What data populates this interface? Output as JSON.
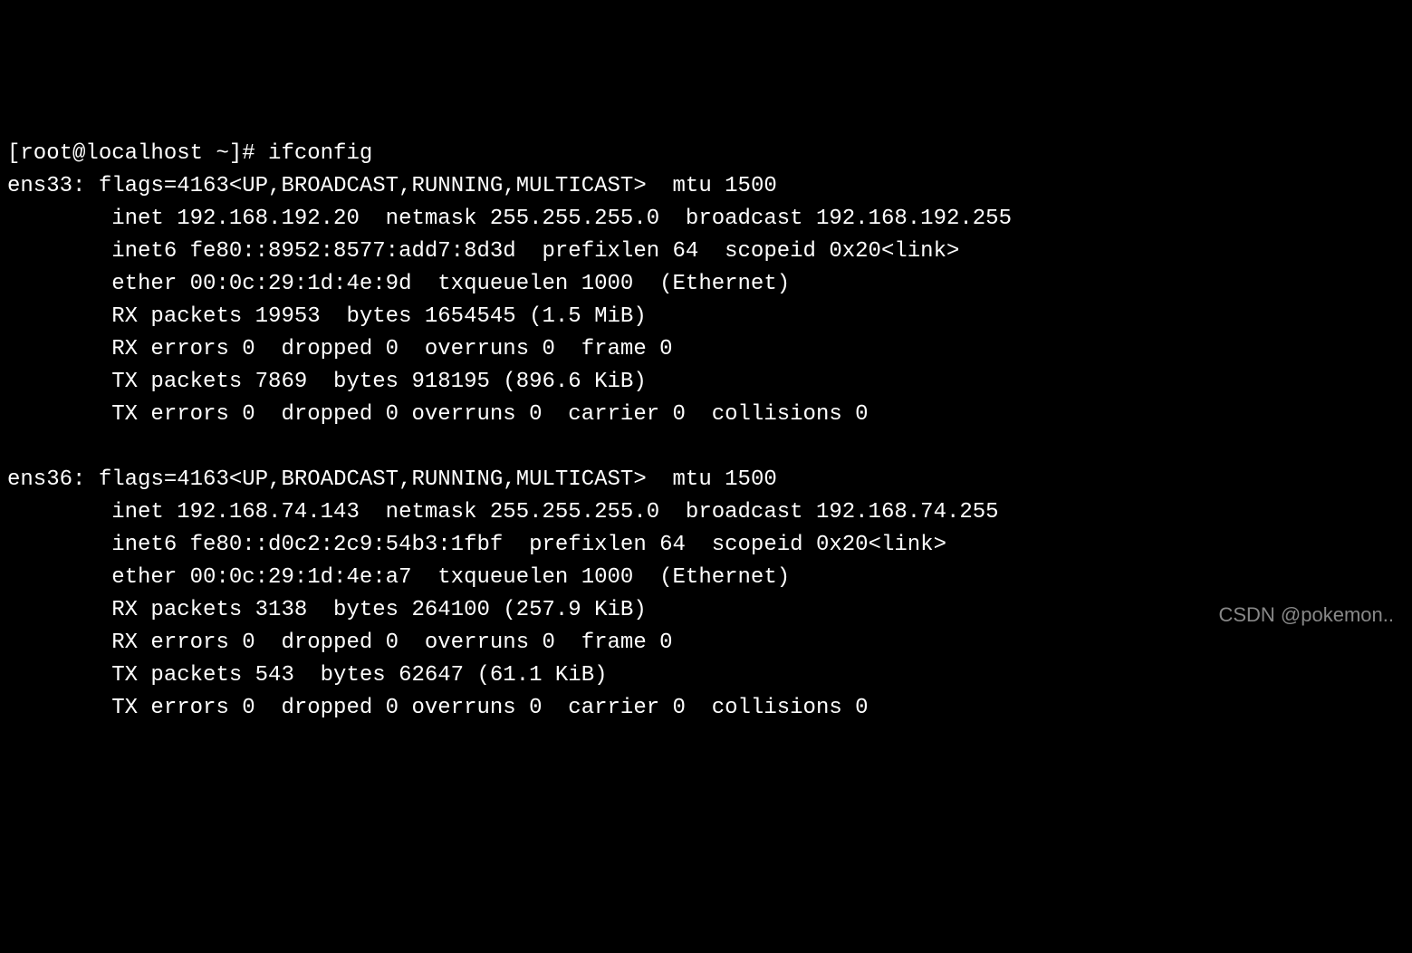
{
  "prompt": "[root@localhost ~]# ",
  "command": "ifconfig",
  "interfaces": [
    {
      "name": "ens33",
      "flags_line": "flags=4163<UP,BROADCAST,RUNNING,MULTICAST>  mtu 1500",
      "inet_line": "inet 192.168.192.20  netmask 255.255.255.0  broadcast 192.168.192.255",
      "inet6_line": "inet6 fe80::8952:8577:add7:8d3d  prefixlen 64  scopeid 0x20<link>",
      "ether_line": "ether 00:0c:29:1d:4e:9d  txqueuelen 1000  (Ethernet)",
      "rx_packets_line": "RX packets 19953  bytes 1654545 (1.5 MiB)",
      "rx_errors_line": "RX errors 0  dropped 0  overruns 0  frame 0",
      "tx_packets_line": "TX packets 7869  bytes 918195 (896.6 KiB)",
      "tx_errors_line": "TX errors 0  dropped 0 overruns 0  carrier 0  collisions 0"
    },
    {
      "name": "ens36",
      "flags_line": "flags=4163<UP,BROADCAST,RUNNING,MULTICAST>  mtu 1500",
      "inet_line": "inet 192.168.74.143  netmask 255.255.255.0  broadcast 192.168.74.255",
      "inet6_line": "inet6 fe80::d0c2:2c9:54b3:1fbf  prefixlen 64  scopeid 0x20<link>",
      "ether_line": "ether 00:0c:29:1d:4e:a7  txqueuelen 1000  (Ethernet)",
      "rx_packets_line": "RX packets 3138  bytes 264100 (257.9 KiB)",
      "rx_errors_line": "RX errors 0  dropped 0  overruns 0  frame 0",
      "tx_packets_line": "TX packets 543  bytes 62647 (61.1 KiB)",
      "tx_errors_line": "TX errors 0  dropped 0 overruns 0  carrier 0  collisions 0"
    }
  ],
  "watermark": "CSDN @pokemon.."
}
